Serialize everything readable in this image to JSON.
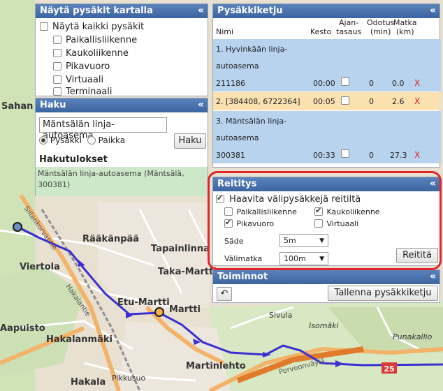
{
  "map": {
    "places": [
      "Sahan",
      "Viertola",
      "Rääkänpää",
      "Tapainlinna",
      "Taka-Martti",
      "Etu-Martti",
      "Martti",
      "Hakalanmäki",
      "Martinlehto",
      "Hakala",
      "Pikkusuo",
      "Sivula",
      "Isomäki",
      "Punakallio",
      "Aapuisto"
    ],
    "roads": [
      "Sillankorvantie",
      "Porvoonväylä",
      "Hakalantie"
    ],
    "road_badge": "25"
  },
  "stops_layer": {
    "title": "Näytä pysäkit kartalla",
    "show_all": "Näytä kaikki pysäkit",
    "types": [
      "Paikallisliikenne",
      "Kaukoliikenne",
      "Pikavuoro",
      "Virtuaali",
      "Terminaali"
    ]
  },
  "search": {
    "title": "Haku",
    "input_value": "Mäntsälän linja-autoasema",
    "opt_stop": "Pysäkki",
    "opt_place": "Paikka",
    "button": "Haku",
    "results_heading": "Hakutulokset",
    "result_line1": "Mäntsälän linja-autoasema (Mäntsälä,",
    "result_line2": "300381)"
  },
  "route": {
    "title": "Pysäkkiketju",
    "col_name": "Nimi",
    "col_duration": "Kesto",
    "col_timing_1": "Ajan-",
    "col_timing_2": "tasaus",
    "col_wait_1": "Odotus",
    "col_wait_2": "(min)",
    "col_dist_1": "Matka",
    "col_dist_2": "(km)",
    "rows": [
      {
        "name1": "1. Hyvinkään linja-",
        "name2": "autoasema",
        "id": "211186",
        "duration": "00:00",
        "wait": "0",
        "dist": "0.0",
        "del": "X"
      },
      {
        "name1": "2. [384408, 6722364]",
        "duration": "00:05",
        "wait": "0",
        "dist": "2.6",
        "del": "X"
      },
      {
        "name1": "3. Mäntsälän linja-",
        "name2": "autoasema",
        "id": "300381",
        "duration": "00:33",
        "wait": "0",
        "dist": "27.3",
        "del": "X"
      }
    ]
  },
  "routing": {
    "title": "Reititys",
    "fetch_intermediate": "Haavita välipysäkkejä reitiltä",
    "opt_local": "Paikallisliikenne",
    "opt_long": "Kaukoliikenne",
    "opt_express": "Pikavuoro",
    "opt_virtual": "Virtuaali",
    "radius_label": "Säde",
    "radius_value": "5m",
    "interval_label": "Välimatka",
    "interval_value": "100m",
    "button": "Reititä"
  },
  "actions": {
    "title": "Toiminnot",
    "undo": "↶",
    "save": "Tallenna pysäkkiketju"
  },
  "collapse_glyph": "«"
}
